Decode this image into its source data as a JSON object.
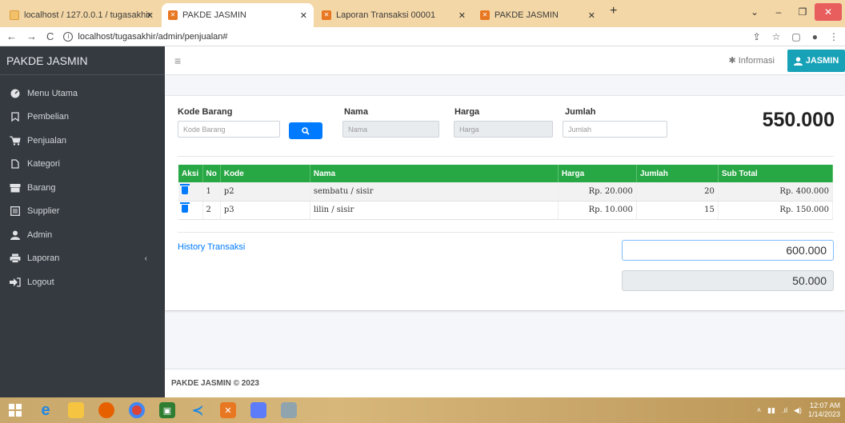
{
  "browser": {
    "tabs": [
      {
        "label": "localhost / 127.0.0.1 / tugasakhir",
        "close": "✕"
      },
      {
        "label": "PAKDE JASMIN",
        "close": "✕"
      },
      {
        "label": "Laporan Transaksi 00001",
        "close": "✕"
      },
      {
        "label": "PAKDE JASMIN",
        "close": "✕"
      }
    ],
    "new_tab": "+",
    "url": "localhost/tugasakhir/admin/penjualan#"
  },
  "sidebar": {
    "brand": "PAKDE JASMIN",
    "items": [
      {
        "label": "Menu Utama",
        "icon": "dashboard-icon"
      },
      {
        "label": "Pembelian",
        "icon": "bookmark-icon"
      },
      {
        "label": "Penjualan",
        "icon": "cart-icon"
      },
      {
        "label": "Kategori",
        "icon": "file-icon"
      },
      {
        "label": "Barang",
        "icon": "box-icon"
      },
      {
        "label": "Supplier",
        "icon": "list-icon"
      },
      {
        "label": "Admin",
        "icon": "user-icon"
      },
      {
        "label": "Laporan",
        "icon": "print-icon",
        "caret": "‹"
      },
      {
        "label": "Logout",
        "icon": "logout-icon"
      }
    ]
  },
  "topnav": {
    "menu_icon": "≡",
    "info_label": "Informasi",
    "user_label": "JASMIN"
  },
  "form": {
    "kode_label": "Kode Barang",
    "kode_placeholder": "Kode Barang",
    "nama_label": "Nama",
    "nama_placeholder": "Nama",
    "harga_label": "Harga",
    "harga_placeholder": "Harga",
    "jumlah_label": "Jumlah",
    "jumlah_placeholder": "Jumlah",
    "total": "550.000"
  },
  "table": {
    "headers": [
      "Aksi",
      "No",
      "Kode",
      "Nama",
      "Harga",
      "Jumlah",
      "Sub Total"
    ],
    "rows": [
      {
        "no": "1",
        "kode": "p2",
        "nama": "sembatu / sisir",
        "harga": "Rp. 20.000",
        "jumlah": "20",
        "subtotal": "Rp. 400.000"
      },
      {
        "no": "2",
        "kode": "p3",
        "nama": "lilin / sisir",
        "harga": "Rp. 10.000",
        "jumlah": "15",
        "subtotal": "Rp. 150.000"
      }
    ]
  },
  "payment": {
    "history_link": "History Transaksi",
    "bayar": "600.000",
    "kembali": "50.000"
  },
  "footer": {
    "text": "PAKDE JASMIN © 2023"
  },
  "taskbar": {
    "time": "12:07 AM",
    "date": "1/14/2023"
  },
  "colors": {
    "sidebar": "#343a40",
    "table_header": "#28a745",
    "primary": "#007bff",
    "info": "#17a2b8"
  }
}
